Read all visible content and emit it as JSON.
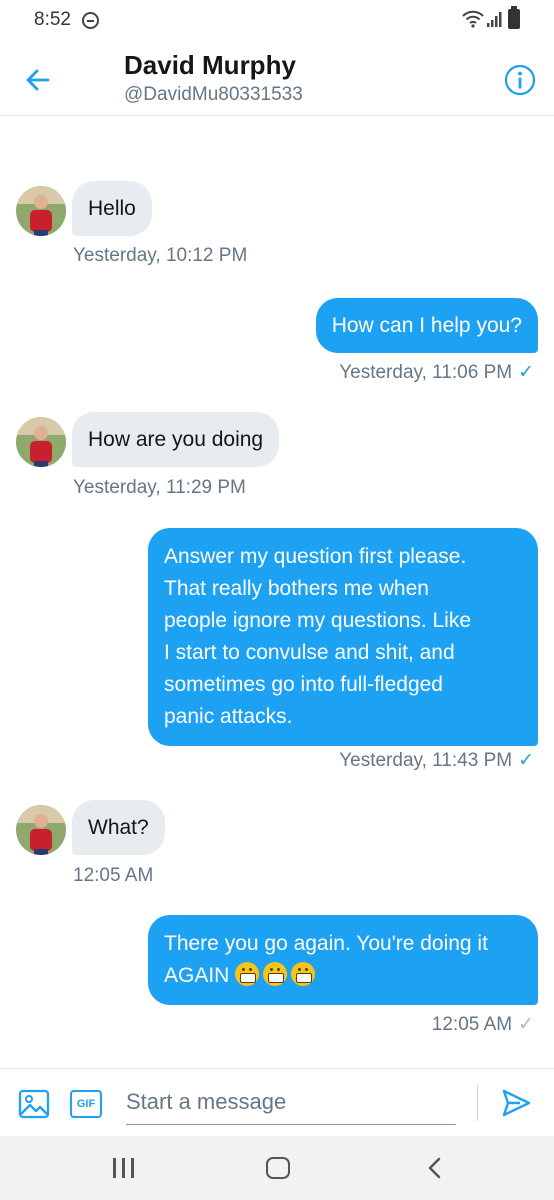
{
  "status_bar": {
    "time": "8:52"
  },
  "header": {
    "name": "David Murphy",
    "handle": "@DavidMu80331533"
  },
  "messages": [
    {
      "direction": "received",
      "text": "Hello",
      "timestamp": "Yesterday, 10:12 PM"
    },
    {
      "direction": "sent",
      "text": "How can I help you?",
      "timestamp": "Yesterday, 11:06 PM",
      "status": "✓"
    },
    {
      "direction": "received",
      "text": "How are you doing",
      "timestamp": "Yesterday, 11:29 PM"
    },
    {
      "direction": "sent",
      "lines": [
        "Answer my question first please.",
        "That really bothers me when",
        "people ignore my questions. Like",
        "I start to convulse and shit, and",
        "sometimes go into full-fledged",
        "panic attacks."
      ],
      "timestamp": "Yesterday, 11:43 PM",
      "status": "✓"
    },
    {
      "direction": "received",
      "text": "What?",
      "timestamp": "12:05 AM"
    },
    {
      "direction": "sent",
      "lines": [
        "There you go again. You're doing it",
        "AGAIN"
      ],
      "emojis": [
        "grimacing-face",
        "grimacing-face",
        "grimacing-face"
      ],
      "timestamp": "12:05 AM",
      "status": "✓"
    }
  ],
  "composer": {
    "gif_label": "GIF",
    "placeholder": "Start a message"
  },
  "colors": {
    "accent": "#1da1f2",
    "received_bubble": "#e6ecf0",
    "secondary_text": "#657786"
  }
}
